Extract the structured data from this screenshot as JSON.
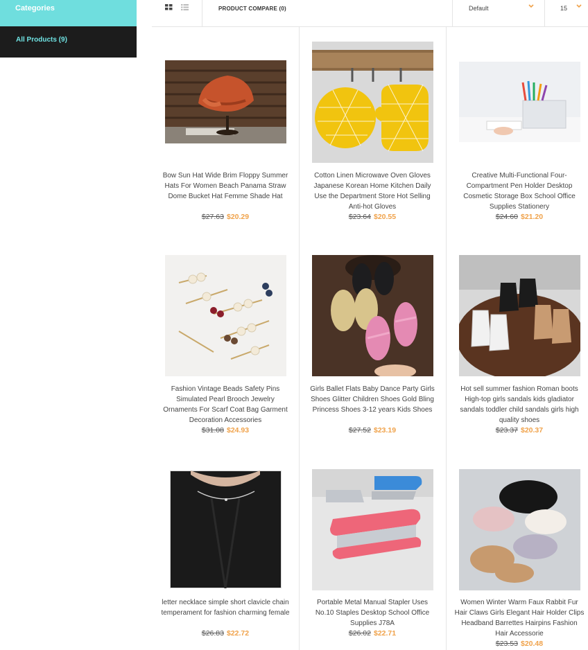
{
  "sidebar": {
    "heading": "Categories",
    "items": [
      {
        "label": "All Products (9)"
      }
    ]
  },
  "toolbar": {
    "view_modes": [
      "grid",
      "list"
    ],
    "compare_label": "PRODUCT COMPARE (0)",
    "sort_value": "Default",
    "limit_value": "15"
  },
  "colors": {
    "accent_teal": "#6fdede",
    "sidebar_dark": "#1c1c1c",
    "price_orange": "#f0a24a"
  },
  "products": [
    {
      "title": "Bow Sun Hat Wide Brim Floppy Summer Hats For Women Beach Panama Straw Dome Bucket Hat Femme Shade Hat",
      "old_price": "$27.63",
      "new_price": "$20.29",
      "image": "straw-hat-photo"
    },
    {
      "title": "Cotton Linen Microwave Oven Gloves Japanese Korean Home Kitchen Daily Use the Department Store Hot Selling Anti-hot Gloves",
      "old_price": "$23.64",
      "new_price": "$20.55",
      "image": "oven-gloves-photo"
    },
    {
      "title": "Creative Multi-Functional Four-Compartment Pen Holder Desktop Cosmetic Storage Box School Office Supplies Stationery",
      "old_price": "$24.60",
      "new_price": "$21.20",
      "image": "pen-holder-photo"
    },
    {
      "title": "Fashion Vintage Beads Safety Pins Simulated Pearl Brooch Jewelry Ornaments For Scarf Coat Bag Garment Decoration Accessories",
      "old_price": "$31.08",
      "new_price": "$24.93",
      "image": "brooch-pins-photo"
    },
    {
      "title": "Girls Ballet Flats Baby Dance Party Girls Shoes Glitter Children Shoes Gold Bling Princess Shoes 3-12 years Kids Shoes",
      "old_price": "$27.52",
      "new_price": "$23.19",
      "image": "glitter-shoes-photo"
    },
    {
      "title": "Hot sell summer fashion Roman boots High-top girls sandals kids gladiator sandals toddler child sandals girls high quality shoes",
      "old_price": "$23.37",
      "new_price": "$20.37",
      "image": "sandals-photo"
    },
    {
      "title": "letter necklace simple short clavicle chain temperament for fashion charming female",
      "old_price": "$26.83",
      "new_price": "$22.72",
      "image": "necklace-photo"
    },
    {
      "title": "Portable Metal Manual Stapler Uses No.10 Staples Desktop School Office Supplies J78A",
      "old_price": "$26.02",
      "new_price": "$22.71",
      "image": "stapler-photo"
    },
    {
      "title": "Women Winter Warm Faux Rabbit Fur Hair Claws Girls Elegant Hair Holder Clips Headband Barrettes Hairpins Fashion Hair Accessorie",
      "old_price": "$23.53",
      "new_price": "$20.48",
      "image": "hair-claws-photo"
    }
  ]
}
